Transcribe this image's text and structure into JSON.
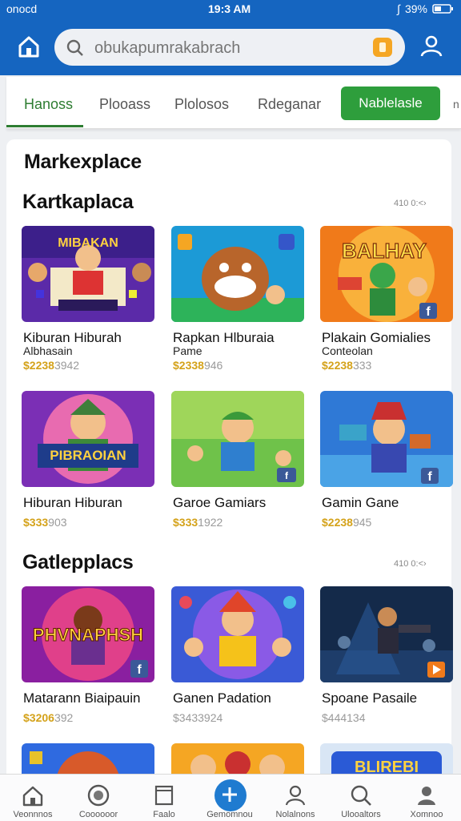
{
  "status": {
    "carrier": "onocd",
    "time": "19:3 AM",
    "battery": "39%"
  },
  "search": {
    "placeholder": "obukapumrakabrach"
  },
  "tabs": [
    "Hanoss",
    "Plooass",
    "Plolosos",
    "Rdeganar"
  ],
  "tab_button": "Nablelasle",
  "tab_more": "n",
  "page_title": "Markexplace",
  "sections": [
    {
      "title": "Kartkaplaca",
      "see_all": "410 0:<›",
      "cards": [
        {
          "title": "Kiburan Hiburah",
          "subtitle": "Albhasain",
          "price_gold": "$2238",
          "price_grey": "3942",
          "art": "purple"
        },
        {
          "title": "Rapkan Hlburaia",
          "subtitle": "Pame",
          "price_gold": "$2338",
          "price_grey": "946",
          "art": "blue"
        },
        {
          "title": "Plakain Gomialies",
          "subtitle": "Conteolan",
          "price_gold": "$2238",
          "price_grey": "333",
          "art": "orange"
        }
      ]
    },
    {
      "title": "",
      "see_all": "",
      "cards": [
        {
          "title": "Hiburan Hiburan",
          "subtitle": "",
          "price_gold": "$333",
          "price_grey": "903",
          "art": "purple2"
        },
        {
          "title": "Garoe Gamiars",
          "subtitle": "",
          "price_gold": "$333",
          "price_grey": "1922",
          "art": "green"
        },
        {
          "title": "Gamin Gane",
          "subtitle": "",
          "price_gold": "$2238",
          "price_grey": "945",
          "art": "blue2"
        }
      ]
    },
    {
      "title": "Gatlepplacs",
      "see_all": "410 0:<›",
      "cards": [
        {
          "title": "Matarann Biaipauin",
          "subtitle": "",
          "price_gold": "$3206",
          "price_grey": "392",
          "art": "magenta"
        },
        {
          "title": "Ganen Padation",
          "subtitle": "",
          "price_gold": "",
          "price_grey": "$3433924",
          "art": "blue3"
        },
        {
          "title": "Spoane Pasaile",
          "subtitle": "",
          "price_gold": "",
          "price_grey": "$444134",
          "art": "dark"
        }
      ]
    }
  ],
  "bottom_nav": [
    "Veonnnos",
    "Coooooor",
    "Faalo",
    "Gemomnou",
    "Nolalnons",
    "Ulooaltors",
    "Xomnoo"
  ],
  "colors": {
    "brand": "#1565c0",
    "accent_green": "#2e9e3c",
    "price_gold": "#d4a21a"
  }
}
